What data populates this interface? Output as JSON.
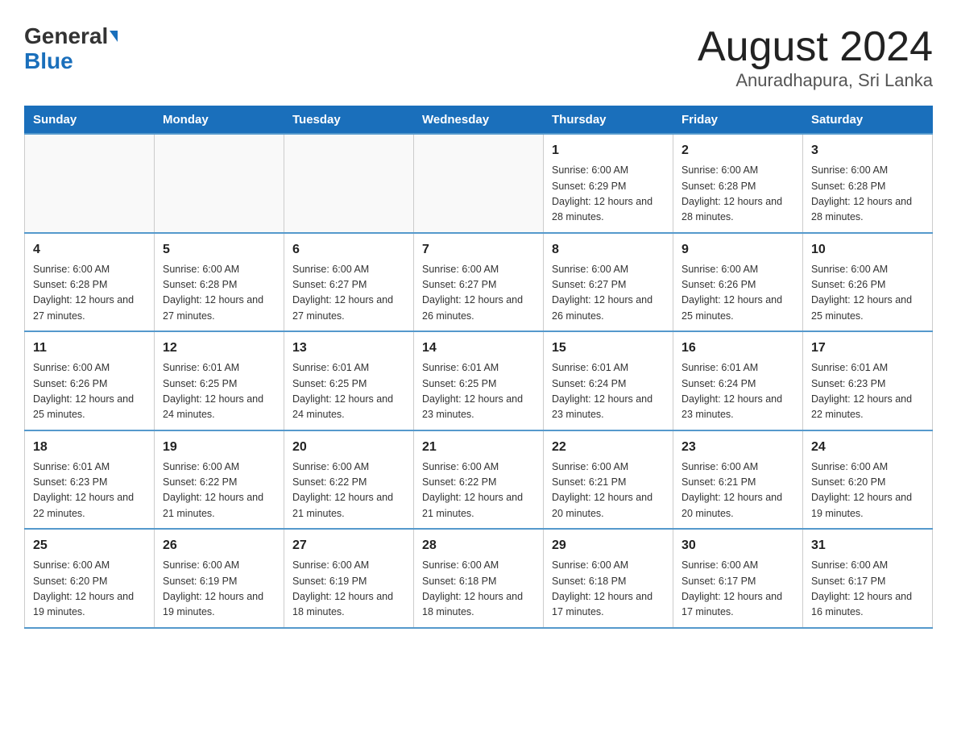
{
  "header": {
    "logo_line1": "General",
    "logo_line2": "Blue",
    "month_title": "August 2024",
    "location": "Anuradhapura, Sri Lanka"
  },
  "days_of_week": [
    "Sunday",
    "Monday",
    "Tuesday",
    "Wednesday",
    "Thursday",
    "Friday",
    "Saturday"
  ],
  "weeks": [
    [
      {
        "day": "",
        "info": ""
      },
      {
        "day": "",
        "info": ""
      },
      {
        "day": "",
        "info": ""
      },
      {
        "day": "",
        "info": ""
      },
      {
        "day": "1",
        "info": "Sunrise: 6:00 AM\nSunset: 6:29 PM\nDaylight: 12 hours and 28 minutes."
      },
      {
        "day": "2",
        "info": "Sunrise: 6:00 AM\nSunset: 6:28 PM\nDaylight: 12 hours and 28 minutes."
      },
      {
        "day": "3",
        "info": "Sunrise: 6:00 AM\nSunset: 6:28 PM\nDaylight: 12 hours and 28 minutes."
      }
    ],
    [
      {
        "day": "4",
        "info": "Sunrise: 6:00 AM\nSunset: 6:28 PM\nDaylight: 12 hours and 27 minutes."
      },
      {
        "day": "5",
        "info": "Sunrise: 6:00 AM\nSunset: 6:28 PM\nDaylight: 12 hours and 27 minutes."
      },
      {
        "day": "6",
        "info": "Sunrise: 6:00 AM\nSunset: 6:27 PM\nDaylight: 12 hours and 27 minutes."
      },
      {
        "day": "7",
        "info": "Sunrise: 6:00 AM\nSunset: 6:27 PM\nDaylight: 12 hours and 26 minutes."
      },
      {
        "day": "8",
        "info": "Sunrise: 6:00 AM\nSunset: 6:27 PM\nDaylight: 12 hours and 26 minutes."
      },
      {
        "day": "9",
        "info": "Sunrise: 6:00 AM\nSunset: 6:26 PM\nDaylight: 12 hours and 25 minutes."
      },
      {
        "day": "10",
        "info": "Sunrise: 6:00 AM\nSunset: 6:26 PM\nDaylight: 12 hours and 25 minutes."
      }
    ],
    [
      {
        "day": "11",
        "info": "Sunrise: 6:00 AM\nSunset: 6:26 PM\nDaylight: 12 hours and 25 minutes."
      },
      {
        "day": "12",
        "info": "Sunrise: 6:01 AM\nSunset: 6:25 PM\nDaylight: 12 hours and 24 minutes."
      },
      {
        "day": "13",
        "info": "Sunrise: 6:01 AM\nSunset: 6:25 PM\nDaylight: 12 hours and 24 minutes."
      },
      {
        "day": "14",
        "info": "Sunrise: 6:01 AM\nSunset: 6:25 PM\nDaylight: 12 hours and 23 minutes."
      },
      {
        "day": "15",
        "info": "Sunrise: 6:01 AM\nSunset: 6:24 PM\nDaylight: 12 hours and 23 minutes."
      },
      {
        "day": "16",
        "info": "Sunrise: 6:01 AM\nSunset: 6:24 PM\nDaylight: 12 hours and 23 minutes."
      },
      {
        "day": "17",
        "info": "Sunrise: 6:01 AM\nSunset: 6:23 PM\nDaylight: 12 hours and 22 minutes."
      }
    ],
    [
      {
        "day": "18",
        "info": "Sunrise: 6:01 AM\nSunset: 6:23 PM\nDaylight: 12 hours and 22 minutes."
      },
      {
        "day": "19",
        "info": "Sunrise: 6:00 AM\nSunset: 6:22 PM\nDaylight: 12 hours and 21 minutes."
      },
      {
        "day": "20",
        "info": "Sunrise: 6:00 AM\nSunset: 6:22 PM\nDaylight: 12 hours and 21 minutes."
      },
      {
        "day": "21",
        "info": "Sunrise: 6:00 AM\nSunset: 6:22 PM\nDaylight: 12 hours and 21 minutes."
      },
      {
        "day": "22",
        "info": "Sunrise: 6:00 AM\nSunset: 6:21 PM\nDaylight: 12 hours and 20 minutes."
      },
      {
        "day": "23",
        "info": "Sunrise: 6:00 AM\nSunset: 6:21 PM\nDaylight: 12 hours and 20 minutes."
      },
      {
        "day": "24",
        "info": "Sunrise: 6:00 AM\nSunset: 6:20 PM\nDaylight: 12 hours and 19 minutes."
      }
    ],
    [
      {
        "day": "25",
        "info": "Sunrise: 6:00 AM\nSunset: 6:20 PM\nDaylight: 12 hours and 19 minutes."
      },
      {
        "day": "26",
        "info": "Sunrise: 6:00 AM\nSunset: 6:19 PM\nDaylight: 12 hours and 19 minutes."
      },
      {
        "day": "27",
        "info": "Sunrise: 6:00 AM\nSunset: 6:19 PM\nDaylight: 12 hours and 18 minutes."
      },
      {
        "day": "28",
        "info": "Sunrise: 6:00 AM\nSunset: 6:18 PM\nDaylight: 12 hours and 18 minutes."
      },
      {
        "day": "29",
        "info": "Sunrise: 6:00 AM\nSunset: 6:18 PM\nDaylight: 12 hours and 17 minutes."
      },
      {
        "day": "30",
        "info": "Sunrise: 6:00 AM\nSunset: 6:17 PM\nDaylight: 12 hours and 17 minutes."
      },
      {
        "day": "31",
        "info": "Sunrise: 6:00 AM\nSunset: 6:17 PM\nDaylight: 12 hours and 16 minutes."
      }
    ]
  ]
}
